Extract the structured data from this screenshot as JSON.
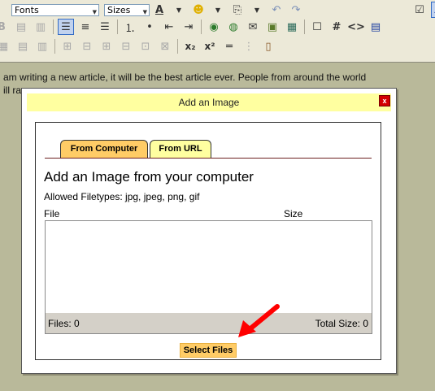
{
  "toolbar": {
    "fonts_label": "Fonts",
    "sizes_label": "Sizes",
    "subscript_label": "x₂",
    "superscript_label": "x²",
    "hash_label": "#",
    "code_label": "<>"
  },
  "editor": {
    "line1": "am writing a new article, it will be the best article ever.  People from around the world",
    "line2": "ill ra"
  },
  "dialog": {
    "title": "Add an Image",
    "close_label": "x",
    "tabs": [
      {
        "label": "From Computer",
        "active": true
      },
      {
        "label": "From URL",
        "active": false
      }
    ],
    "heading": "Add an Image from your computer",
    "filetypes": "Allowed Filetypes: jpg, jpeg, png, gif",
    "col_file": "File",
    "col_size": "Size",
    "files_count": "Files: 0",
    "total_size": "Total Size: 0",
    "select_button": "Select Files"
  },
  "colors": {
    "title_bar": "#ffffa0",
    "tab_active": "#ffcc66",
    "close_red": "#d40000",
    "arrow_red": "#ff0000",
    "editor_bg": "#b9b99a"
  }
}
